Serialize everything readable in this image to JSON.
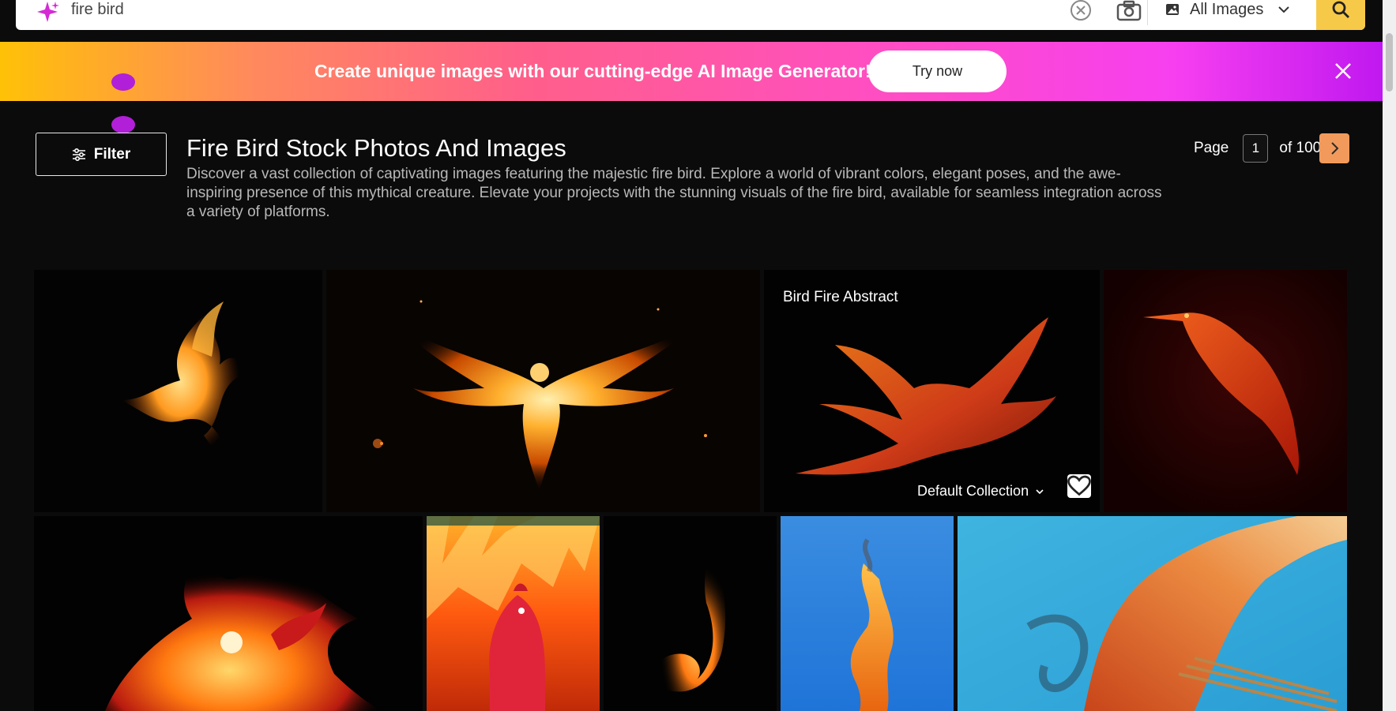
{
  "search": {
    "query": "fire bird",
    "type_label": "All Images"
  },
  "banner": {
    "text": "Create unique images with our cutting-edge AI Image Generator!",
    "button_label": "Try now"
  },
  "toolbar": {
    "filter_label": "Filter"
  },
  "header": {
    "title": "Fire Bird Stock Photos And Images",
    "description": "Discover a vast collection of captivating images featuring the majestic fire bird. Explore a world of vibrant colors, elegant poses, and the awe-inspiring presence of this mythical creature. Elevate your projects with the stunning visuals of the fire bird, available for seamless integration across a variety of platforms."
  },
  "pagination": {
    "page_label": "Page",
    "current_page": "1",
    "of_label": "of 100"
  },
  "grid": {
    "hovered_tile": {
      "title": "Bird Fire Abstract",
      "collection_label": "Default Collection"
    }
  },
  "colors": {
    "background": "#0b0b0b",
    "accent_yellow": "#f7c948",
    "pager_accent": "#f19a5b",
    "banner_start": "#ffc107",
    "banner_end": "#c018f0"
  },
  "icons": {
    "search_brand": "sparkle-icon",
    "clear": "clear-icon",
    "camera": "camera-icon",
    "image_type": "image-icon",
    "dropdown": "chevron-down-icon",
    "submit": "search-icon",
    "banner_close": "close-icon",
    "filter": "sliders-icon",
    "next": "chevron-right-icon",
    "favorite": "heart-icon"
  }
}
